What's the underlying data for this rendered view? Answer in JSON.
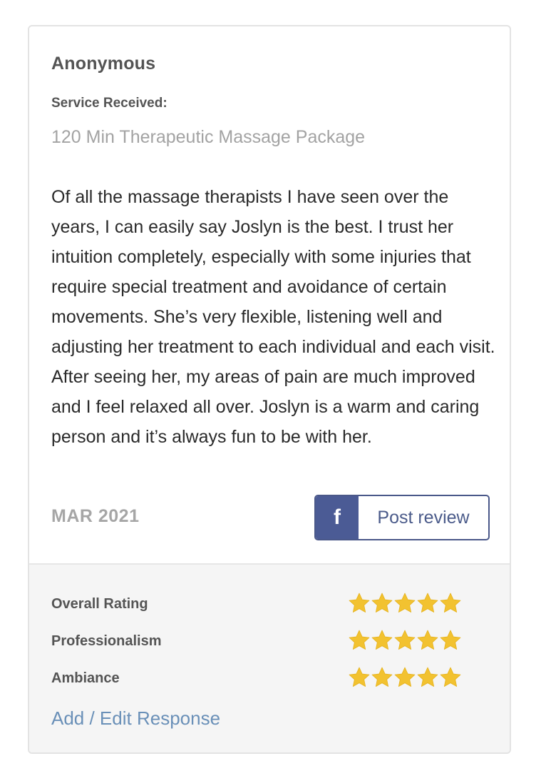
{
  "review": {
    "reviewer": "Anonymous",
    "service_label": "Service Received:",
    "service_value": "120 Min Therapeutic Massage Package",
    "text": "Of all the massage therapists I have seen over the years, I can easily say Joslyn is the best. I trust her intuition completely, especially with some injuries that require special treatment and avoidance of certain movements. She’s very flexible, listening well and adjusting her treatment to each individual and each visit. After seeing her, my areas of pain are much improved and I feel relaxed all over. Joslyn is a warm and caring person and it’s always fun to be with her.",
    "date": "MAR 2021"
  },
  "share": {
    "icon": "facebook-icon",
    "icon_glyph": "f",
    "label": "Post review",
    "brand_color": "#4b5b95"
  },
  "ratings": [
    {
      "label": "Overall Rating",
      "stars": 5,
      "max": 5
    },
    {
      "label": "Professionalism",
      "stars": 5,
      "max": 5
    },
    {
      "label": "Ambiance",
      "stars": 5,
      "max": 5
    }
  ],
  "star_color": "#f2c230",
  "response_link": "Add / Edit Response"
}
